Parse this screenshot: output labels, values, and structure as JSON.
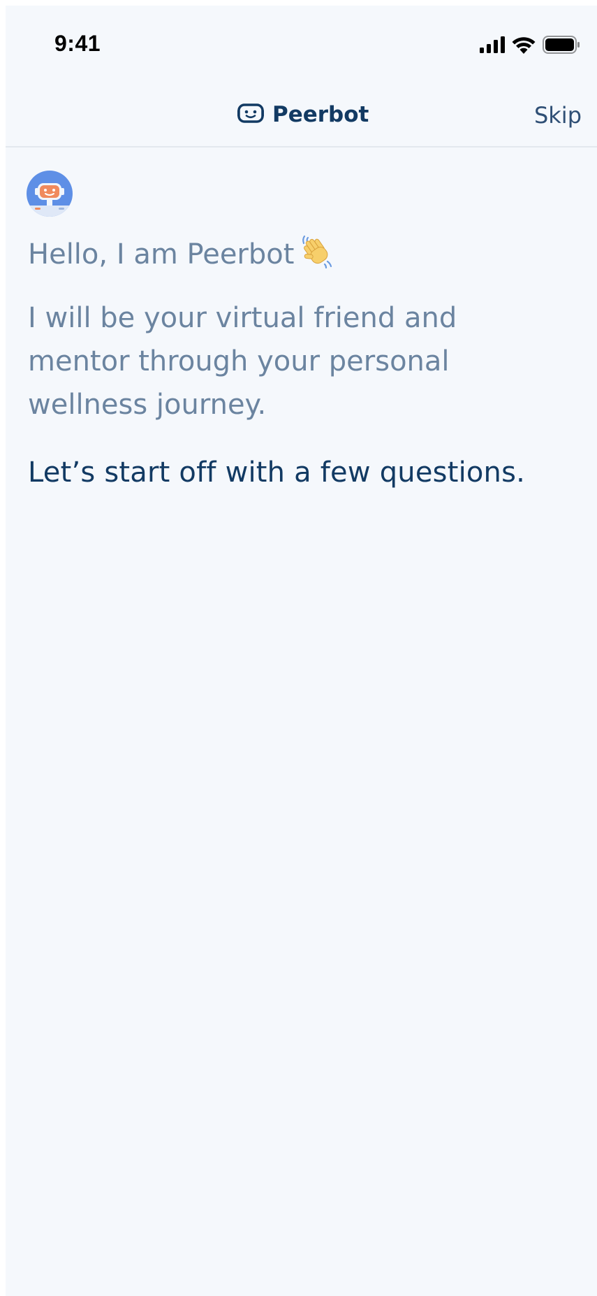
{
  "status_bar": {
    "time": "9:41",
    "icons": [
      "cellular-signal-icon",
      "wifi-icon",
      "battery-icon"
    ]
  },
  "nav": {
    "title": "Peerbot",
    "logo_icon": "robot-face-icon",
    "skip_label": "Skip"
  },
  "chat": {
    "avatar_icon": "peerbot-avatar-icon",
    "greeting": "Hello, I am Peerbot",
    "greeting_emoji_icon": "waving-hand-icon",
    "intro_lines": [
      "I will be your virtual friend and",
      "mentor through your personal",
      "wellness journey."
    ],
    "cta": "Let’s start off with a few questions."
  },
  "colors": {
    "background": "#f5f8fc",
    "primary_text": "#123a63",
    "secondary_text": "#6b84a0",
    "divider": "#e3e8ee",
    "avatar_blue": "#5e8fe6",
    "avatar_orange": "#f08a5d"
  }
}
